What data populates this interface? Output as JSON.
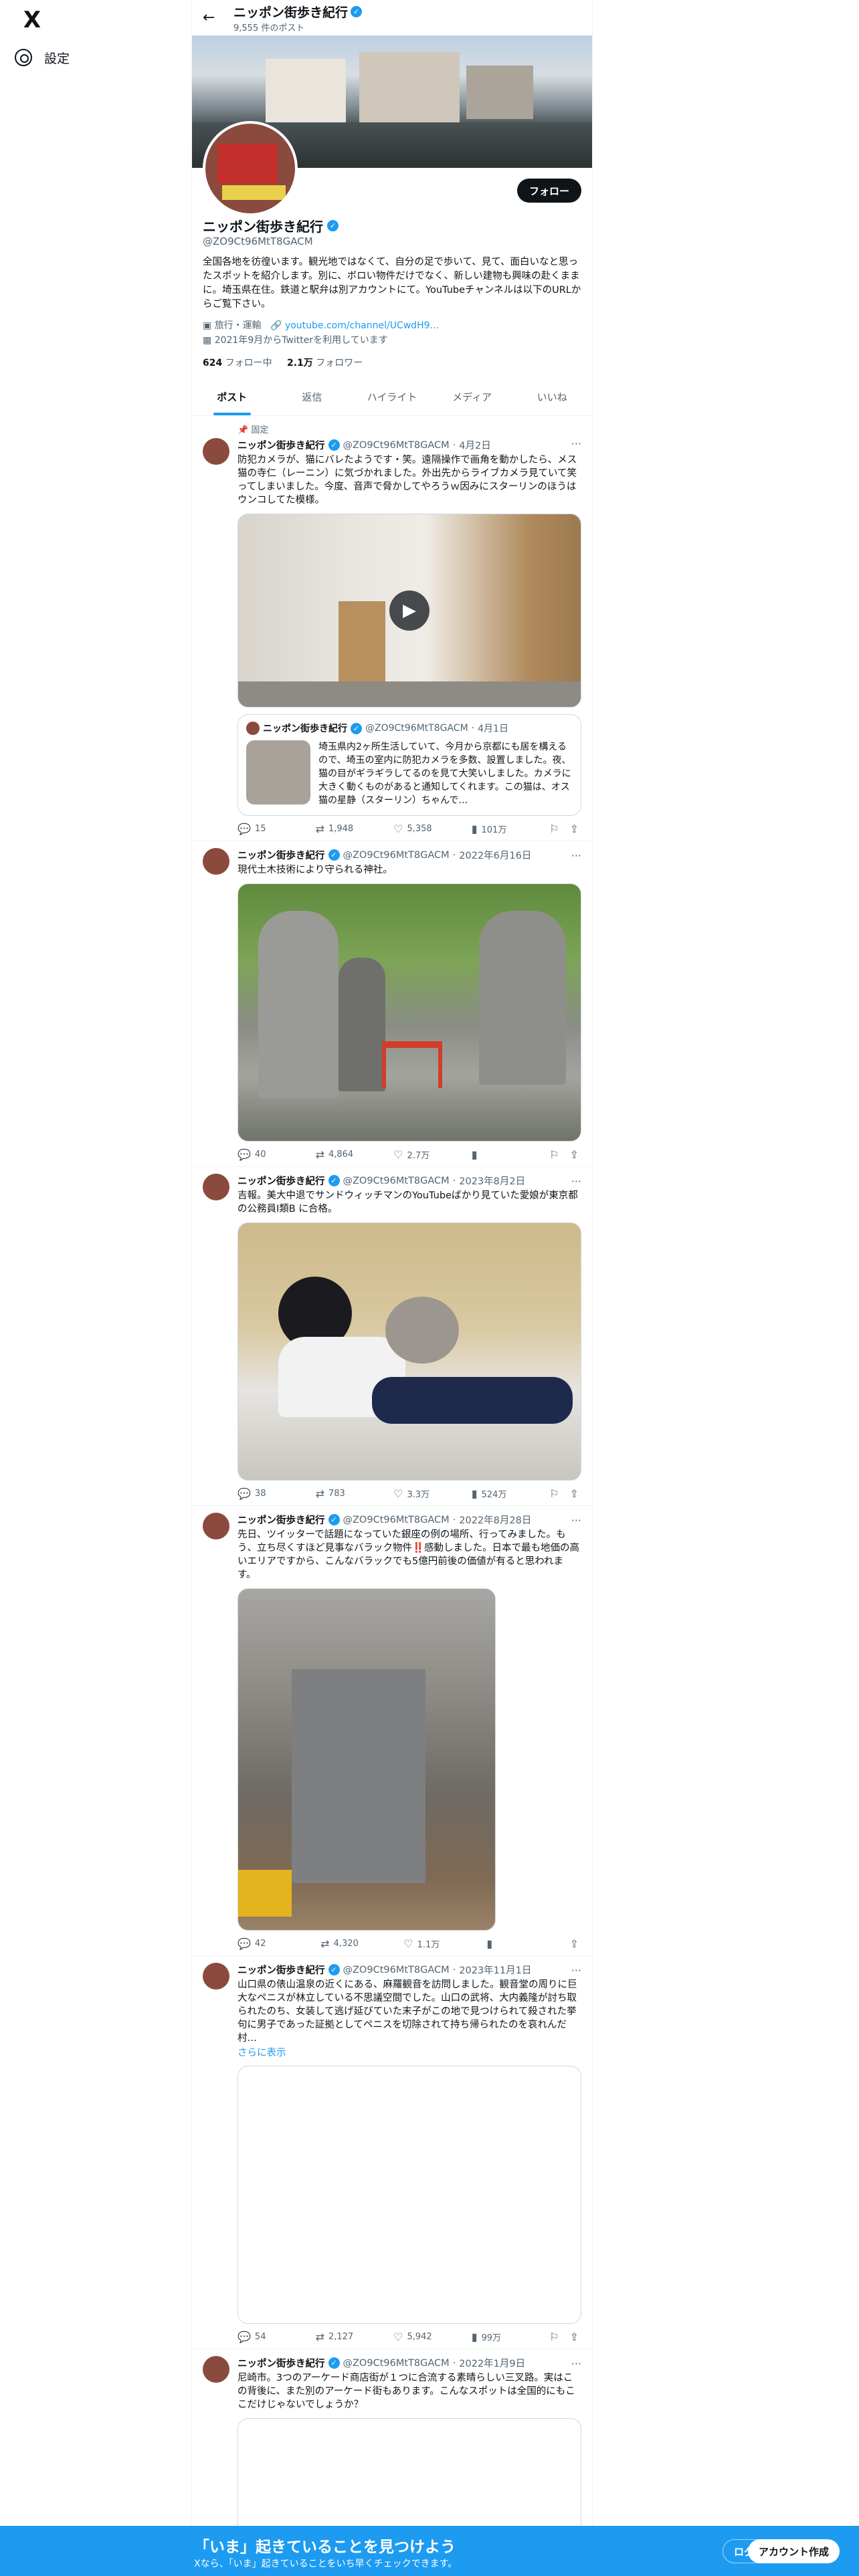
{
  "nav": {
    "logo": "X",
    "settings_label": "設定"
  },
  "topbar": {
    "title": "ニッポン街歩き紀行",
    "post_count": "9,555 件のポスト"
  },
  "profile": {
    "name": "ニッポン街歩き紀行",
    "handle": "@ZO9Ct96MtT8GACM",
    "follow_button": "フォロー",
    "bio": "全国各地を彷徨います。観光地ではなくて、自分の足で歩いて、見て、面白いなと思ったスポットを紹介します。別に、ボロい物件だけでなく、新しい建物も興味の赴くままに。埼玉県在住。鉄道と駅弁は別アカウントにて。YouTubeチャンネルは以下のURLからご覧下さい。",
    "category": "旅行・運輸",
    "link": "youtube.com/channel/UCwdH9…",
    "joined": "2021年9月からTwitterを利用しています",
    "following_count": "624",
    "following_label": "フォロー中",
    "followers_count": "2.1万",
    "followers_label": "フォロワー"
  },
  "tabs": [
    "ポスト",
    "返信",
    "ハイライト",
    "メディア",
    "いいね"
  ],
  "posts": [
    {
      "pinned": "固定",
      "name": "ニッポン街歩き紀行",
      "handle": "@ZO9Ct96MtT8GACM",
      "date": "4月2日",
      "text": "防犯カメラが、猫にバレたようです・笑。遠隔操作で画角を動かしたら、メス猫の寺仁（レーニン）に気づかれました。外出先からライブカメラ見ていて笑ってしまいました。今度、音声で脅かしてやろうｗ因みにスターリンのほうはウンコしてた模様。",
      "quote": {
        "name": "ニッポン街歩き紀行",
        "handle": "@ZO9Ct96MtT8GACM",
        "date": "4月1日",
        "text": "埼玉県内2ヶ所生活していて、今月から京都にも居を構えるので、埼玉の室内に防犯カメラを多数、設置しました。夜、猫の目がギラギラしてるのを見て大笑いしました。カメラに大きく動くものがあると通知してくれます。この猫は、オス猫の星静（スターリン）ちゃんで…"
      },
      "stats": {
        "replies": "15",
        "reposts": "1,948",
        "likes": "5,358",
        "views": "101万"
      }
    },
    {
      "name": "ニッポン街歩き紀行",
      "handle": "@ZO9Ct96MtT8GACM",
      "date": "2022年6月16日",
      "text": "現代土木技術により守られる神社。",
      "stats": {
        "replies": "40",
        "reposts": "4,864",
        "likes": "2.7万",
        "views": ""
      }
    },
    {
      "name": "ニッポン街歩き紀行",
      "handle": "@ZO9Ct96MtT8GACM",
      "date": "2023年8月2日",
      "text": "吉報。美大中退でサンドウィッチマンのYouTubeばかり見ていた愛娘が東京都の公務員I類B に合格。",
      "stats": {
        "replies": "38",
        "reposts": "783",
        "likes": "3.3万",
        "views": "524万"
      }
    },
    {
      "name": "ニッポン街歩き紀行",
      "handle": "@ZO9Ct96MtT8GACM",
      "date": "2022年8月28日",
      "text": "先日、ツイッターで話題になっていた銀座の例の場所、行ってみました。もう、立ち尽くすほど見事なバラック物件‼️感動しました。日本で最も地価の高いエリアですから、こんなバラックでも5億円前後の価値が有ると思われます。",
      "stats": {
        "replies": "42",
        "reposts": "4,320",
        "likes": "1.1万",
        "views": ""
      }
    },
    {
      "name": "ニッポン街歩き紀行",
      "handle": "@ZO9Ct96MtT8GACM",
      "date": "2023年11月1日",
      "text": "山口県の俵山温泉の近くにある、麻羅観音を訪問しました。観音堂の周りに巨大なペニスが林立している不思議空間でした。山口の武将、大内義隆が討ち取られたのち、女装して逃げ延びていた末子がこの地で見つけられて殺された挙句に男子であった証拠としてペニスを切除されて持ち帰られたのを哀れんだ村…",
      "show_more": "さらに表示",
      "stats": {
        "replies": "54",
        "reposts": "2,127",
        "likes": "5,942",
        "views": "99万"
      }
    },
    {
      "name": "ニッポン街歩き紀行",
      "handle": "@ZO9Ct96MtT8GACM",
      "date": "2022年1月9日",
      "text": "尼崎市。3つのアーケード商店街が１つに合流する素晴らしい三叉路。実はこの背後に、また別のアーケード街もあります。こんなスポットは全国的にもここだけじゃないでしょうか？"
    }
  ],
  "bottom_bar": {
    "title": "「いま」起きていることを見つけよう",
    "subtitle": "Xなら、「いま」起きていることをいち早くチェックできます。",
    "login": "ログイン",
    "signup": "アカウント作成"
  },
  "icons": {
    "back": "arrow-left-icon",
    "more": "more-dots-icon",
    "reply": "reply-icon",
    "repost": "repost-icon",
    "like": "heart-icon",
    "views": "views-icon",
    "bookmark": "bookmark-icon",
    "share": "share-icon"
  },
  "colors": {
    "accent": "#1d9bf0",
    "text": "#0f1419",
    "secondary": "#536471"
  }
}
